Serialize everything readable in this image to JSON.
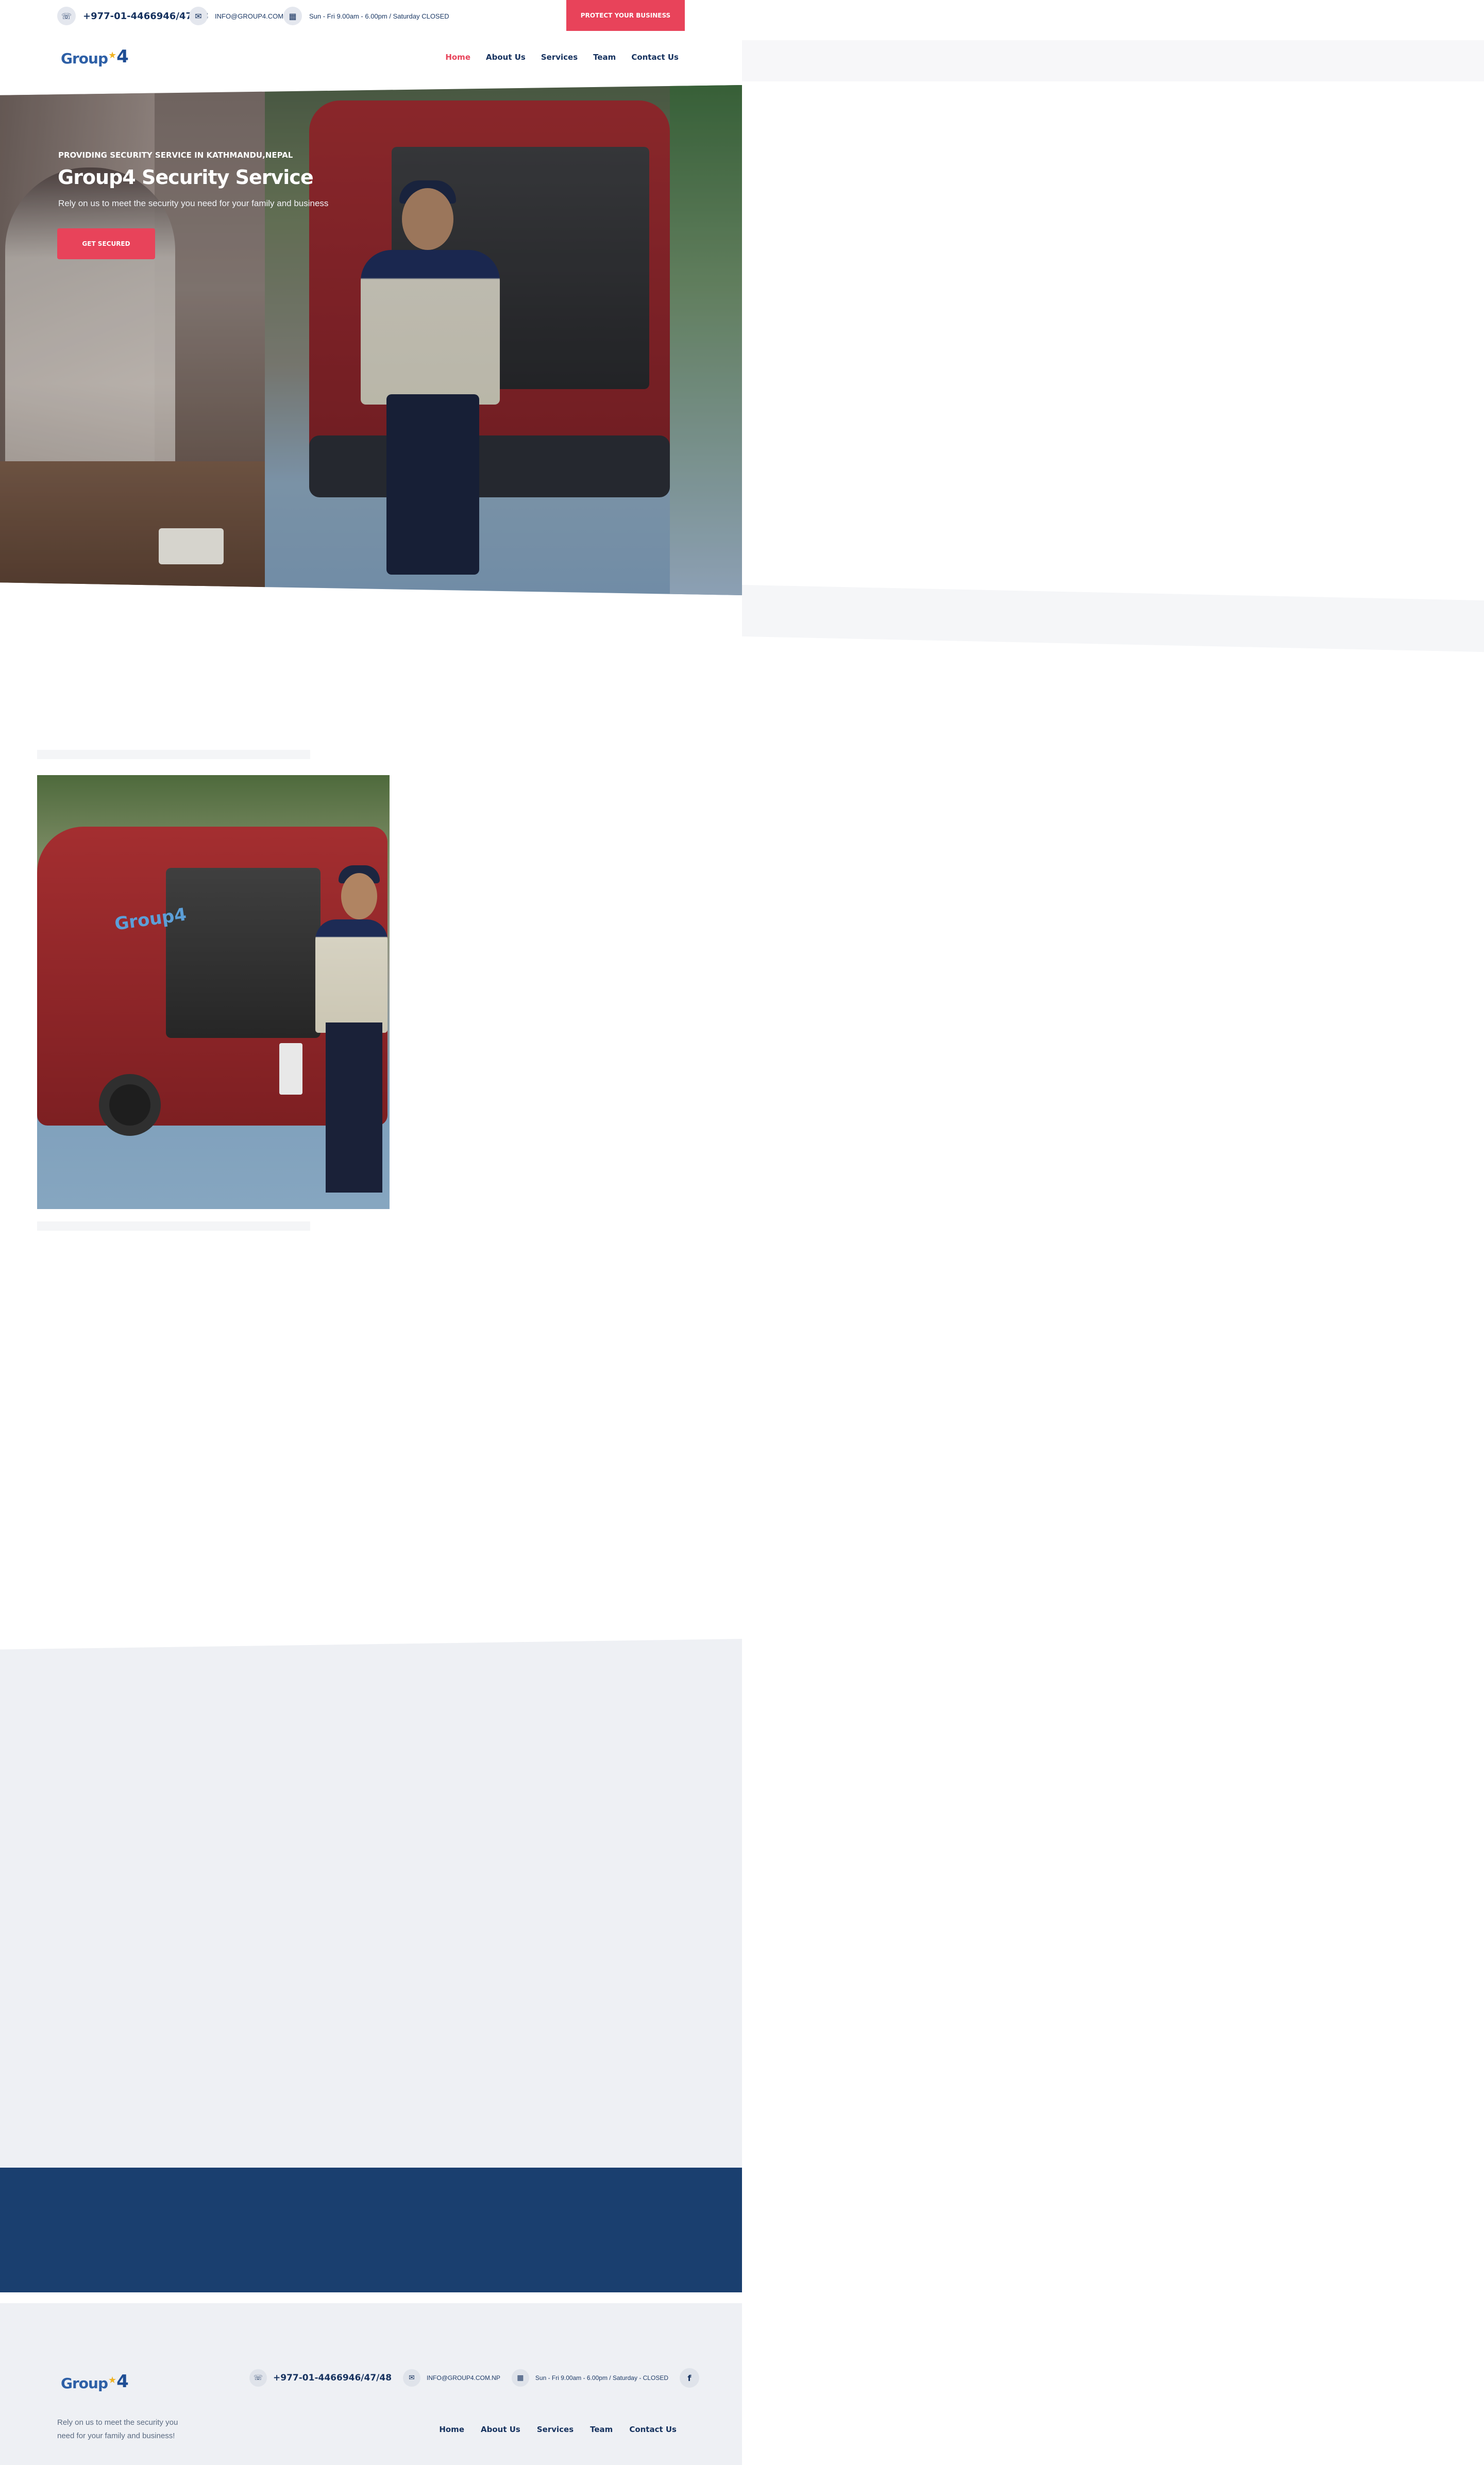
{
  "topbar": {
    "phone": "+977-01-4466946/47/48",
    "email": "INFO@GROUP4.COM.NP",
    "hours": "Sun - Fri 9.00am - 6.00pm / Saturday CLOSED",
    "cta_label": "PROTECT YOUR BUSINESS",
    "icons": [
      "phone-icon",
      "mail-icon",
      "calendar-icon"
    ]
  },
  "brand": {
    "name": "Group",
    "number": "4",
    "colors": {
      "primary": "#15315e",
      "accent": "#e8435a",
      "logo_blue": "#2d5fa6",
      "logo_star": "#f0b323",
      "cta_band": "#1a3f6f"
    }
  },
  "nav": {
    "items": [
      {
        "label": "Home",
        "active": true
      },
      {
        "label": "About Us",
        "active": false
      },
      {
        "label": "Services",
        "active": false
      },
      {
        "label": "Team",
        "active": false
      },
      {
        "label": "Contact Us",
        "active": false
      }
    ]
  },
  "hero": {
    "subtitle": "PROVIDING SECURITY SERVICE IN KATHMANDU,NEPAL",
    "title": "Group4 Security Service",
    "text": "Rely on us to meet the security you need for your family and business",
    "button_label": "GET SECURED"
  },
  "about": {
    "image_logo_text": "Group4"
  },
  "footer": {
    "phone": "+977-01-4466946/47/48",
    "email": "INFO@GROUP4.COM.NP",
    "hours": "Sun - Fri 9.00am - 6.00pm / Saturday - CLOSED",
    "social": "f",
    "tagline": "Rely on us to meet the security you need for your family and business!",
    "nav": [
      "Home",
      "About Us",
      "Services",
      "Team",
      "Contact Us"
    ]
  }
}
